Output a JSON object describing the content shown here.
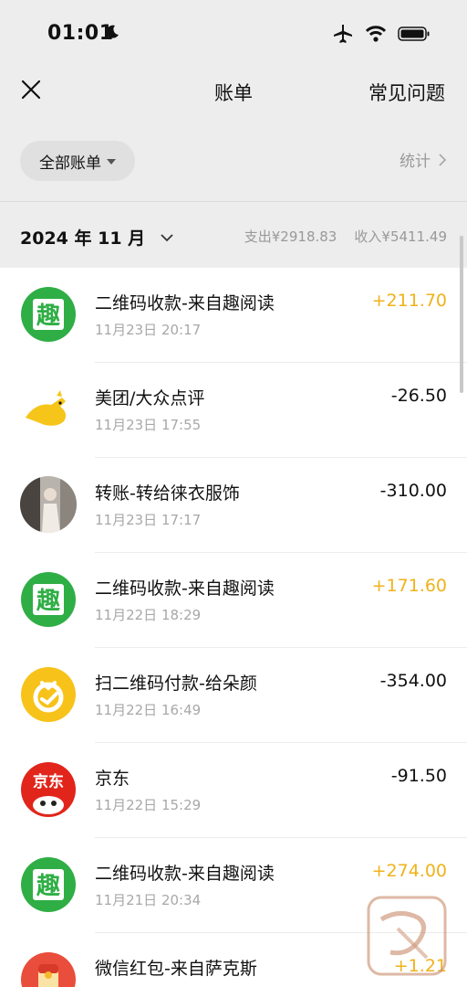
{
  "status_bar": {
    "time": "01:01"
  },
  "nav": {
    "title": "账单",
    "faq": "常见问题"
  },
  "filter": {
    "label": "全部账单",
    "stats": "统计"
  },
  "month": {
    "label": "2024 年 11 月",
    "expense": "支出¥2918.83",
    "income": "收入¥5411.49"
  },
  "colors": {
    "income": "#f0b21a",
    "expense": "#111111"
  },
  "transactions": [
    {
      "title": "二维码收款-来自趣阅读",
      "date": "11月23日 20:17",
      "amount": "+211.70",
      "icon": "qu-reading-icon",
      "type": "income"
    },
    {
      "title": "美团/大众点评",
      "date": "11月23日 17:55",
      "amount": "-26.50",
      "icon": "meituan-kangaroo-icon",
      "type": "expense"
    },
    {
      "title": "转账-转给徕衣服饰",
      "date": "11月23日 17:17",
      "amount": "-310.00",
      "icon": "user-photo-avatar",
      "type": "expense"
    },
    {
      "title": "二维码收款-来自趣阅读",
      "date": "11月22日 18:29",
      "amount": "+171.60",
      "icon": "qu-reading-icon",
      "type": "income"
    },
    {
      "title": "扫二维码付款-给朵颜",
      "date": "11月22日 16:49",
      "amount": "-354.00",
      "icon": "bag-payment-icon",
      "type": "expense"
    },
    {
      "title": "京东",
      "date": "11月22日 15:29",
      "amount": "-91.50",
      "icon": "jd-logo-icon",
      "type": "expense"
    },
    {
      "title": "二维码收款-来自趣阅读",
      "date": "11月21日 20:34",
      "amount": "+274.00",
      "icon": "qu-reading-icon",
      "type": "income"
    },
    {
      "title": "微信红包-来自萨克斯",
      "date": "",
      "amount": "+1.21",
      "icon": "red-packet-icon",
      "type": "income"
    }
  ]
}
